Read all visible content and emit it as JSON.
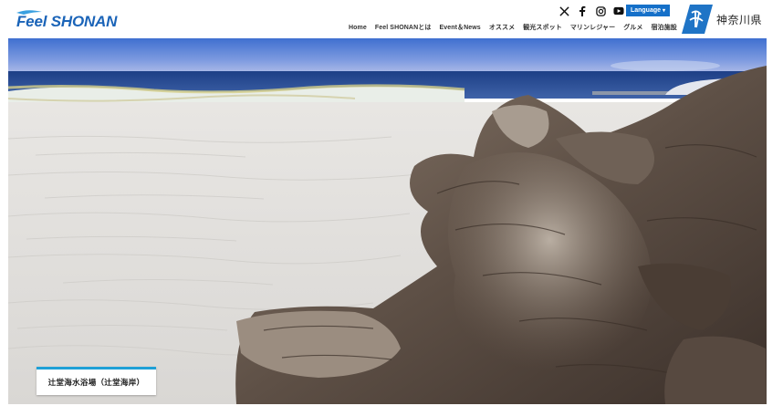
{
  "header": {
    "logo_text": "Feel SHONAN",
    "language_label": "Language",
    "pref_name": "神奈川県",
    "social": [
      {
        "name": "x-icon"
      },
      {
        "name": "facebook-icon"
      },
      {
        "name": "instagram-icon"
      },
      {
        "name": "youtube-icon"
      }
    ],
    "nav": [
      {
        "label": "Home"
      },
      {
        "label": "Feel SHONANとは"
      },
      {
        "label": "Event＆News"
      },
      {
        "label": "オススメ"
      },
      {
        "label": "観光スポット"
      },
      {
        "label": "マリンレジャー"
      },
      {
        "label": "グルメ"
      },
      {
        "label": "宿泊施設"
      }
    ]
  },
  "hero": {
    "caption": "辻堂海水浴場（辻堂海岸）"
  },
  "colors": {
    "brand_blue": "#1b64b8",
    "language_bg": "#1570c9",
    "caption_accent": "#1fa0d6"
  }
}
